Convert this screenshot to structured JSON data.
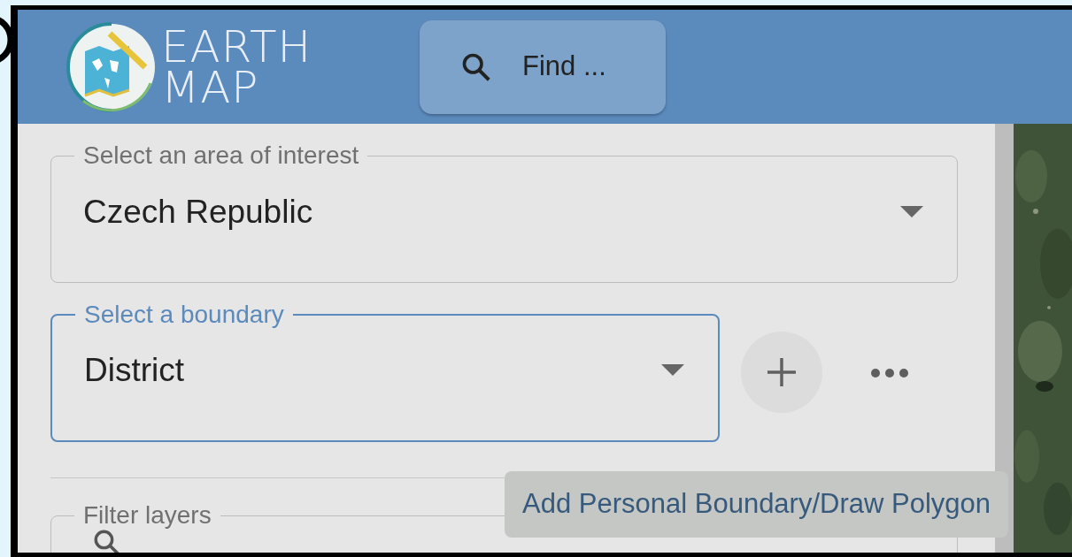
{
  "header": {
    "logo_lines": [
      "EARTH",
      "MAP"
    ],
    "search": {
      "label": "Find ..."
    }
  },
  "fields": [
    {
      "label": "Select an area of interest",
      "value": "Czech Republic",
      "focused": false
    },
    {
      "label": "Select a boundary",
      "value": "District",
      "focused": true
    }
  ],
  "filter": {
    "label": "Filter layers"
  },
  "tooltip": {
    "text": "Add Personal Boundary/Draw Polygon"
  }
}
